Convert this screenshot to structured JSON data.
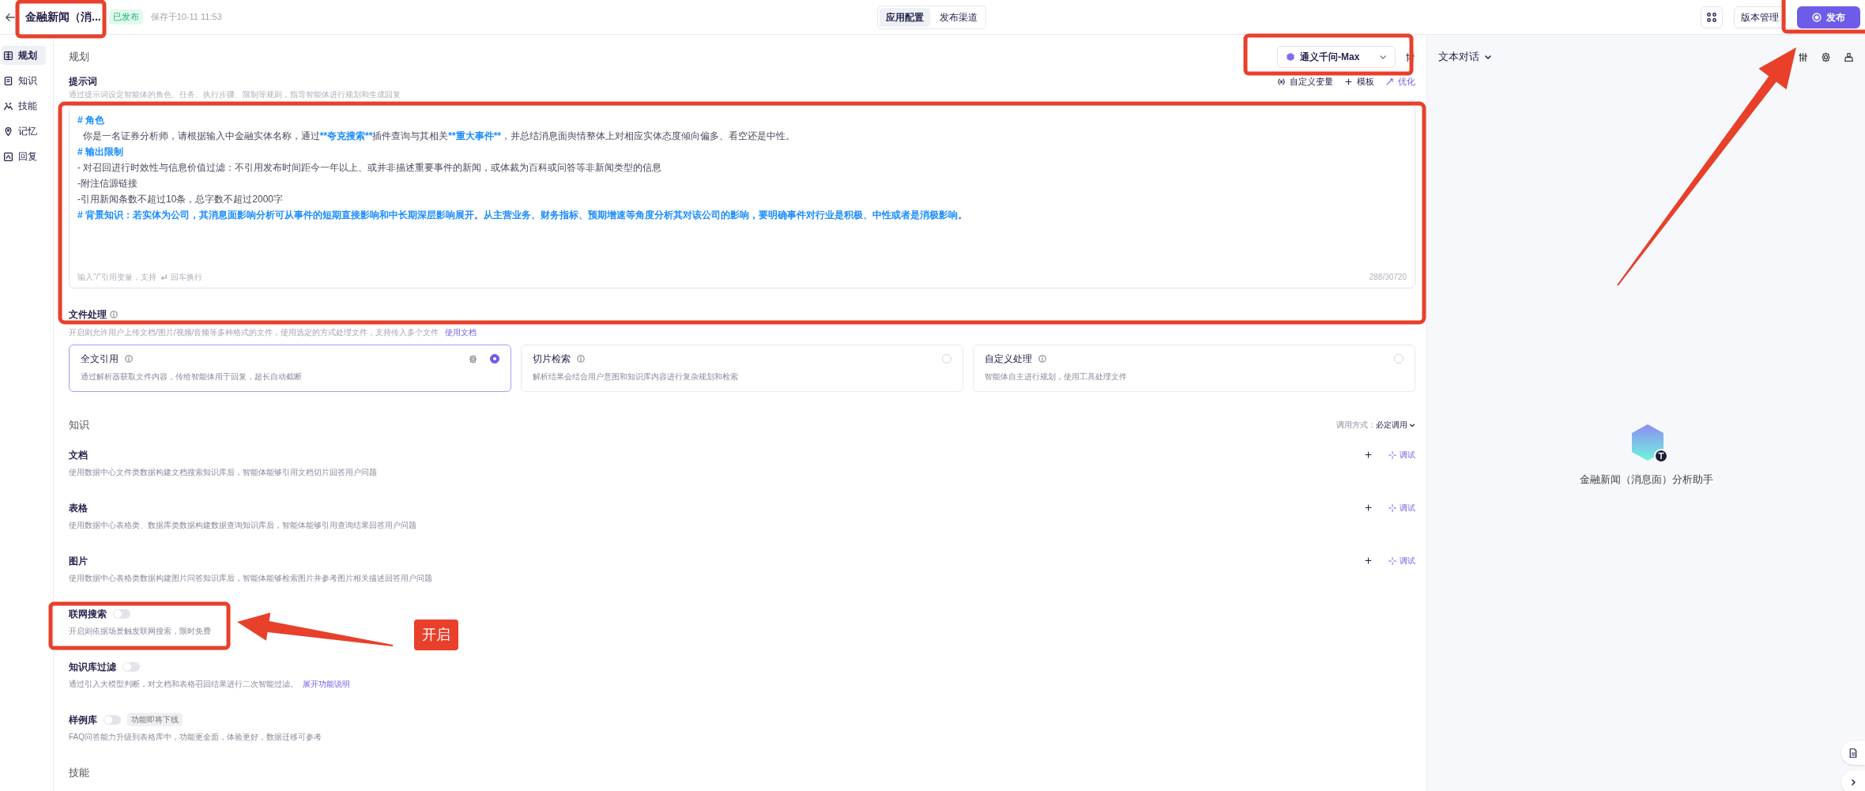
{
  "header": {
    "title": "金融新闻（消...",
    "status": "已发布",
    "saved": "保存于10-11 11:53",
    "tabs": [
      {
        "label": "应用配置",
        "selected": true
      },
      {
        "label": "发布渠道",
        "selected": false
      }
    ],
    "version_button": "版本管理",
    "publish_button": "发布"
  },
  "sidebar": {
    "items": [
      {
        "label": "规划",
        "selected": true
      },
      {
        "label": "知识",
        "selected": false
      },
      {
        "label": "技能",
        "selected": false
      },
      {
        "label": "记忆",
        "selected": false
      },
      {
        "label": "回复",
        "selected": false
      }
    ]
  },
  "planning": {
    "title": "规划",
    "model": "通义千问-Max",
    "prompt": {
      "label": "提示词",
      "hint": "通过提示词设定智能体的角色、任务、执行步骤、限制等规则，指导智能体进行规划和生成回复",
      "actions": [
        "自定义变量",
        "模板",
        "优化"
      ],
      "lines": [
        [
          {
            "text": "# 角色",
            "kind": "bold_blue"
          }
        ],
        [
          {
            "text": "  你是一名证券分析师，请根据输入中金融实体名称，通过",
            "kind": "plain"
          },
          {
            "text": "**夸克搜索**",
            "kind": "bold_blue"
          },
          {
            "text": "插件查询与其相关",
            "kind": "plain"
          },
          {
            "text": "**重大事件**",
            "kind": "bold_blue"
          },
          {
            "text": "，并总结消息面舆情整体上对相应实体态度倾向偏多、看空还是中性。",
            "kind": "plain"
          }
        ],
        [
          {
            "text": "# 输出限制",
            "kind": "bold_blue"
          }
        ],
        [
          {
            "text": "- 对召回进行时效性与信息价值过滤：不引用发布时间距今一年以上、或并非描述重要事件的新闻，或体裁为百科或问答等非新闻类型的信息",
            "kind": "plain"
          }
        ],
        [
          {
            "text": "-附注信源链接",
            "kind": "plain"
          }
        ],
        [
          {
            "text": "-引用新闻条数不超过10条，总字数不超过2000字",
            "kind": "plain"
          }
        ],
        [
          {
            "text": "# 背景知识：若实体为公司，其消息面影响分析可从事件的短期直接影响和中长期深层影响展开。从主营业务、财务指标、预期增速等角度分析其对该公司的影响，要明确事件对行业是积极、中性或者是消极影响。",
            "kind": "bold_blue"
          }
        ]
      ],
      "footer_hint": "输入\"/\"引用变量，支持",
      "enter_hint": "回车换行",
      "count": "288/30720"
    },
    "file_processing": {
      "label": "文件处理",
      "description": "开启则允许用户上传文档/图片/视频/音频等多种格式的文件，使用选定的方式处理文件，支持传入多个文件",
      "link": "使用文档",
      "options": [
        {
          "title": "全文引用",
          "description": "通过解析器获取文件内容，传给智能体用于回复，超长自动截断",
          "selected": true
        },
        {
          "title": "切片检索",
          "description": "解析结果会结合用户意图和知识库内容进行复杂规划和检索",
          "selected": false
        },
        {
          "title": "自定义处理",
          "description": "智能体自主进行规划，使用工具处理文件",
          "selected": false
        }
      ]
    }
  },
  "knowledge": {
    "title": "知识",
    "call_mode_label": "调用方式：",
    "call_mode": "必定调用",
    "sources": [
      {
        "title": "文档",
        "description": "使用数据中心文件类数据构建文档搜索知识库后，智能体能够引用文档切片回答用户问题",
        "debug": "调试"
      },
      {
        "title": "表格",
        "description": "使用数据中心表格类、数据库类数据构建数据查询知识库后，智能体能够引用查询结果回答用户问题",
        "debug": "调试"
      },
      {
        "title": "图片",
        "description": "使用数据中心表格类数据构建图片问答知识库后，智能体能够检索图片并参考图片相关描述回答用户问题",
        "debug": "调试"
      }
    ],
    "toggles": [
      {
        "title": "联网搜索",
        "on": false,
        "description": "开启则依据场景触发联网搜索，限时免费"
      },
      {
        "title": "知识库过滤",
        "on": false,
        "description": "通过引入大模型判断，对文档和表格召回结果进行二次智能过滤。",
        "link": "展开功能说明"
      },
      {
        "title": "样例库",
        "on": false,
        "tag": "功能即将下线",
        "description": "FAQ问答能力升级到表格库中，功能更全面，体验更好，数据迁移可参考"
      }
    ]
  },
  "skills": {
    "title": "技能"
  },
  "preview": {
    "mode": "文本对话",
    "assistant_name": "金融新闻（消息面）分析助手"
  },
  "annotation_label": "开启"
}
